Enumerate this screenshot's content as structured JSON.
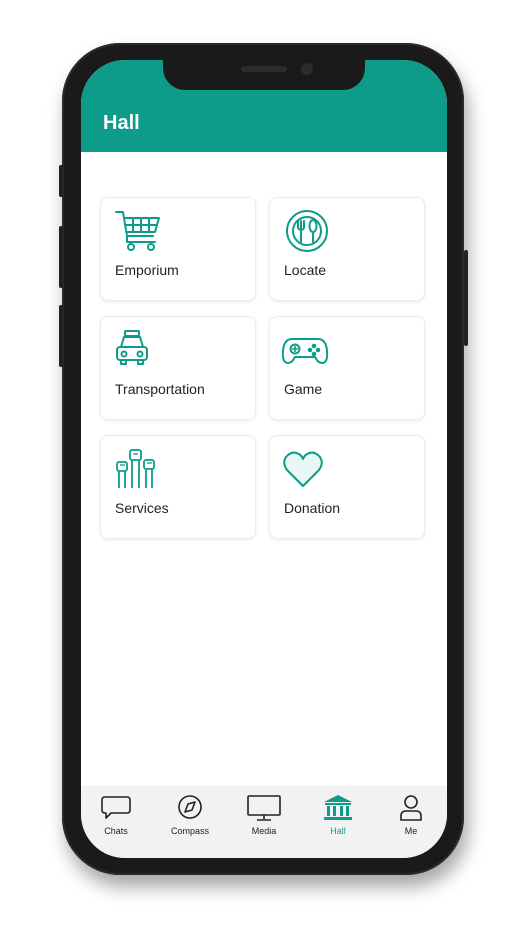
{
  "app": {
    "title": "Hall"
  },
  "accent_color": "#0e9c8a",
  "grid": {
    "items": [
      {
        "label": "Emporium",
        "icon": "shopping-cart-icon"
      },
      {
        "label": "Locate",
        "icon": "restaurant-icon"
      },
      {
        "label": "Transportation",
        "icon": "taxi-icon"
      },
      {
        "label": "Game",
        "icon": "gamepad-icon"
      },
      {
        "label": "Services",
        "icon": "raised-fists-icon"
      },
      {
        "label": "Donation",
        "icon": "heart-icon"
      }
    ]
  },
  "tabbar": {
    "items": [
      {
        "label": "Chats",
        "icon": "chat-bubble-icon"
      },
      {
        "label": "Compass",
        "icon": "compass-icon"
      },
      {
        "label": "Media",
        "icon": "monitor-icon"
      },
      {
        "label": "Hall",
        "icon": "hall-building-icon",
        "active": true
      },
      {
        "label": "Me",
        "icon": "user-icon"
      }
    ]
  }
}
